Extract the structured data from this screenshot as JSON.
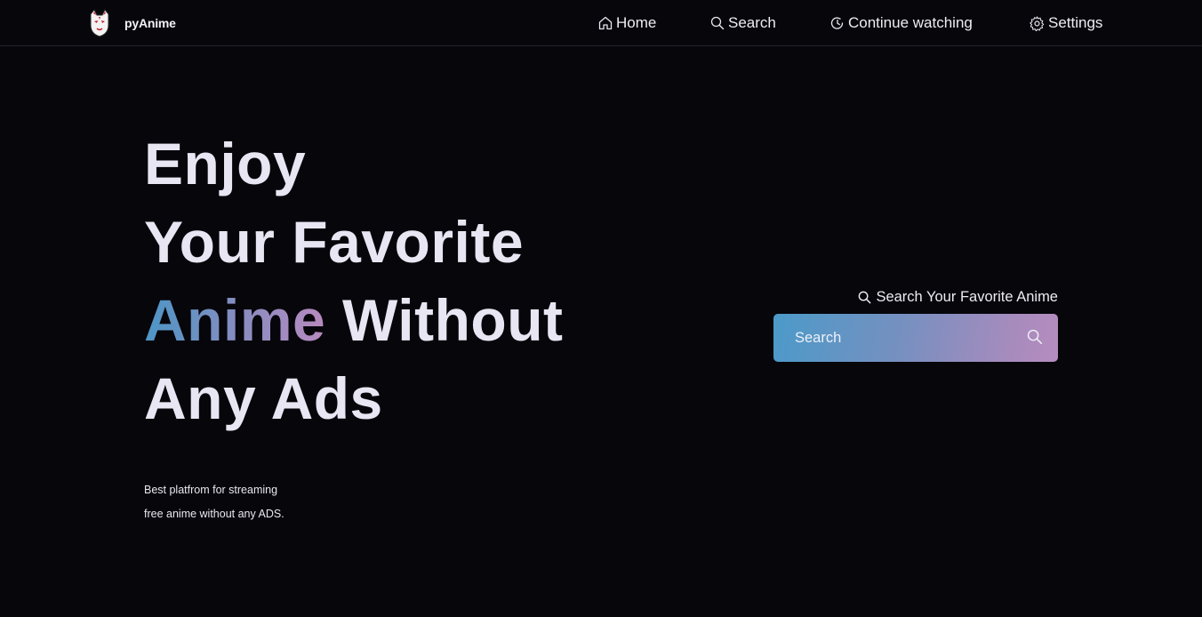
{
  "header": {
    "brand": "pyAnime",
    "nav": [
      {
        "label": "Home",
        "icon": "home-icon"
      },
      {
        "label": "Search",
        "icon": "search-icon"
      },
      {
        "label": "Continue watching",
        "icon": "history-icon"
      },
      {
        "label": "Settings",
        "icon": "gear-icon"
      }
    ]
  },
  "hero": {
    "line1": "Enjoy",
    "line2": "Your Favorite",
    "line3_accent": "Anime",
    "line3_rest": " Without",
    "line4": "Any Ads",
    "sub1": "Best platfrom for streaming",
    "sub2": "free anime without any ADS."
  },
  "search": {
    "label": "Search Your Favorite Anime",
    "placeholder": "Search"
  },
  "colors": {
    "background": "#07060b",
    "accent_start": "#4c96c6",
    "accent_end": "#b88bbf"
  }
}
